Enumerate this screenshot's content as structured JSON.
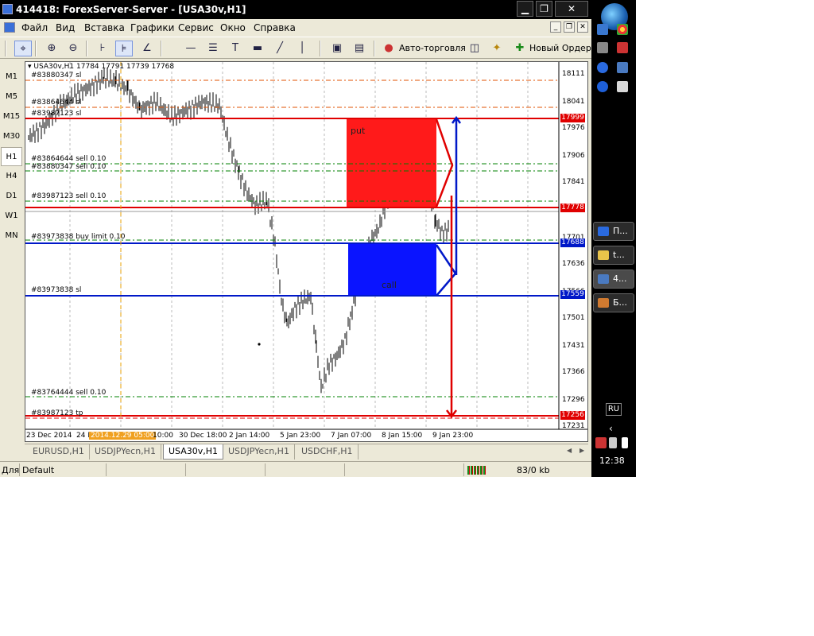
{
  "window": {
    "title": "414418: ForexServer-Server - [USA30v,H1]",
    "controls": {
      "minimize": "▁",
      "maximize": "❐",
      "close": "✕"
    }
  },
  "menu": {
    "items": [
      "Файл",
      "Вид",
      "Вставка",
      "Графики",
      "Сервис",
      "Окно",
      "Справка"
    ],
    "mdi": {
      "minimize": "_",
      "restore": "❐",
      "close": "✕"
    }
  },
  "toolbar": {
    "autotrade_label": "Авто-торговля",
    "new_order_label": "Новый Ордер"
  },
  "timeframes": [
    "M1",
    "M5",
    "M15",
    "M30",
    "H1",
    "H4",
    "D1",
    "W1",
    "MN"
  ],
  "active_timeframe": "H1",
  "chart": {
    "header": "USA30v,H1  17784 17791 17739 17768",
    "price_axis": [
      "18111",
      "18041",
      "17976",
      "17906",
      "17841",
      "17766",
      "17701",
      "17636",
      "17566",
      "17501",
      "17431",
      "17366",
      "17296",
      "17231"
    ],
    "time_axis": [
      "23 Dec 2014",
      "24 D",
      "10:00",
      "30 Dec 18:00",
      "2 Jan 14:00",
      "5 Jan 23:00",
      "7 Jan 07:00",
      "8 Jan 15:00",
      "9 Jan 23:00"
    ],
    "cursor_time": "2014.12.29 05:00",
    "tags": {
      "t17999": "17999",
      "t17778": "17778",
      "t17688": "17688",
      "t17559": "17559",
      "t17256": "17256"
    },
    "orders": {
      "o1": "#83880347 sl",
      "o2": "#83864644 sl",
      "o3": "#83987123 sl",
      "o4": "#83864644 sell 0.10",
      "o5": "#83880347 sell 0.10",
      "o6": "#83987123 sell 0.10",
      "o7": "#83973838 buy limit 0.10",
      "o8": "#83973838 sl",
      "o9": "#83764444 sell 0.10",
      "o10": "#83987123 tp"
    },
    "boxes": {
      "put": "put",
      "call": "call"
    },
    "colors": {
      "put_box": "#ff1a1a",
      "call_box": "#0a14ff",
      "red_line": "#e00000",
      "blue_line": "#0018c8"
    }
  },
  "tabs": [
    "EURUSD,H1",
    "USDJPYecn,H1",
    "USA30v,H1",
    "USDJPYecn,H1",
    "USDCHF,H1"
  ],
  "active_tab": "USA30v,H1",
  "status": {
    "left": "Для",
    "profile": "Default",
    "traffic": "83/0 kb"
  },
  "taskbar": {
    "buttons": [
      "П...",
      "t...",
      "4...",
      "Б..."
    ],
    "language": "RU",
    "clock": "12:38"
  }
}
